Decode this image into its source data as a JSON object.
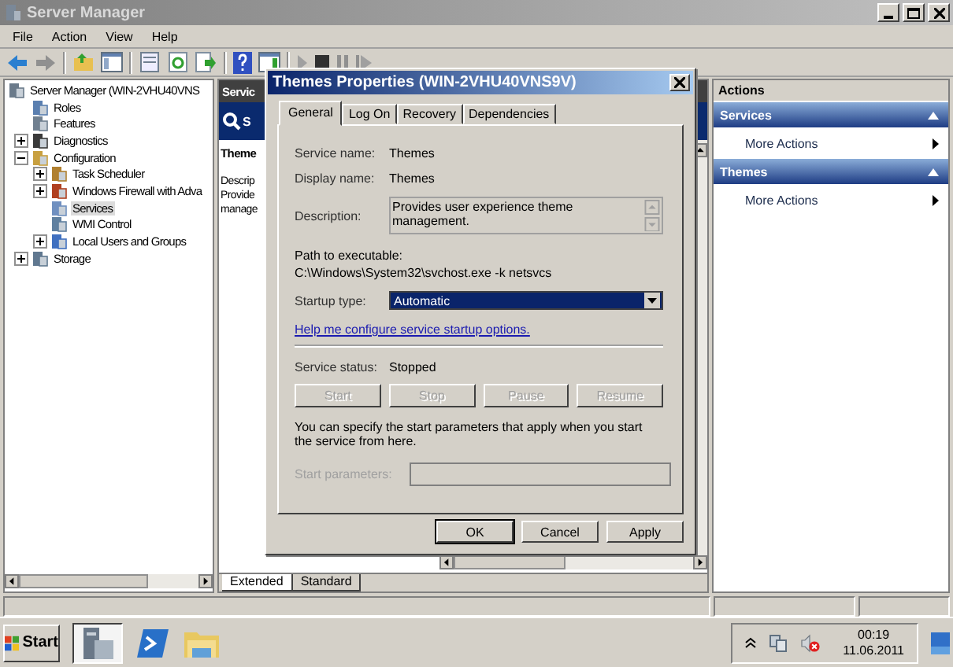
{
  "window": {
    "title": "Server Manager"
  },
  "menu": [
    "File",
    "Action",
    "View",
    "Help"
  ],
  "tree": {
    "items": [
      {
        "label": "Server Manager (WIN-2VHU40VNS",
        "selected": false,
        "children": [
          {
            "label": "Roles",
            "selected": false
          },
          {
            "label": "Features",
            "selected": false
          },
          {
            "label": "Diagnostics",
            "selected": false,
            "expanded": false
          },
          {
            "label": "Configuration",
            "selected": false,
            "expanded": true,
            "children": [
              {
                "label": "Task Scheduler",
                "selected": false,
                "expanded": false
              },
              {
                "label": "Windows Firewall with Adva",
                "selected": false,
                "expanded": false
              },
              {
                "label": "Services",
                "selected": true
              },
              {
                "label": "WMI Control",
                "selected": false
              },
              {
                "label": "Local Users and Groups",
                "selected": false,
                "expanded": false
              }
            ]
          },
          {
            "label": "Storage",
            "selected": false,
            "expanded": false
          }
        ]
      }
    ]
  },
  "middle": {
    "header": "Servic",
    "banner": "S",
    "title": "Theme",
    "lines": [
      "Descrip",
      "Provide",
      "manage"
    ],
    "view_tabs": [
      {
        "label": "Extended",
        "selected": true
      },
      {
        "label": "Standard",
        "selected": false
      }
    ]
  },
  "actions": {
    "title": "Actions",
    "groups": [
      {
        "title": "Services",
        "items": [
          "More Actions"
        ]
      },
      {
        "title": "Themes",
        "items": [
          "More Actions"
        ]
      }
    ]
  },
  "dialog": {
    "title": "Themes Properties (WIN-2VHU40VNS9V)",
    "tabs": [
      {
        "label": "General",
        "selected": true
      },
      {
        "label": "Log On",
        "selected": false
      },
      {
        "label": "Recovery",
        "selected": false
      },
      {
        "label": "Dependencies",
        "selected": false
      }
    ],
    "service_name": {
      "label": "Service name:",
      "value": "Themes"
    },
    "display_name": {
      "label": "Display name:",
      "value": "Themes"
    },
    "description": {
      "label": "Description:",
      "value": "Provides user experience theme management."
    },
    "path": {
      "label": "Path to executable:",
      "value": "C:\\Windows\\System32\\svchost.exe -k netsvcs"
    },
    "startup_type": {
      "label": "Startup type:",
      "value": "Automatic"
    },
    "help_link": "Help me configure service startup options.",
    "service_status": {
      "label": "Service status:",
      "value": "Stopped"
    },
    "control_buttons": [
      {
        "label": "Start",
        "disabled": true
      },
      {
        "label": "Stop",
        "disabled": true
      },
      {
        "label": "Pause",
        "disabled": true
      },
      {
        "label": "Resume",
        "disabled": true
      }
    ],
    "note": "You can specify the start parameters that apply when you start the service from here.",
    "start_parameters": {
      "label": "Start parameters:",
      "disabled": true
    },
    "buttons": [
      "OK",
      "Cancel",
      "Apply"
    ]
  },
  "taskbar": {
    "start": "Start",
    "time": "00:19",
    "date": "11.06.2011"
  }
}
